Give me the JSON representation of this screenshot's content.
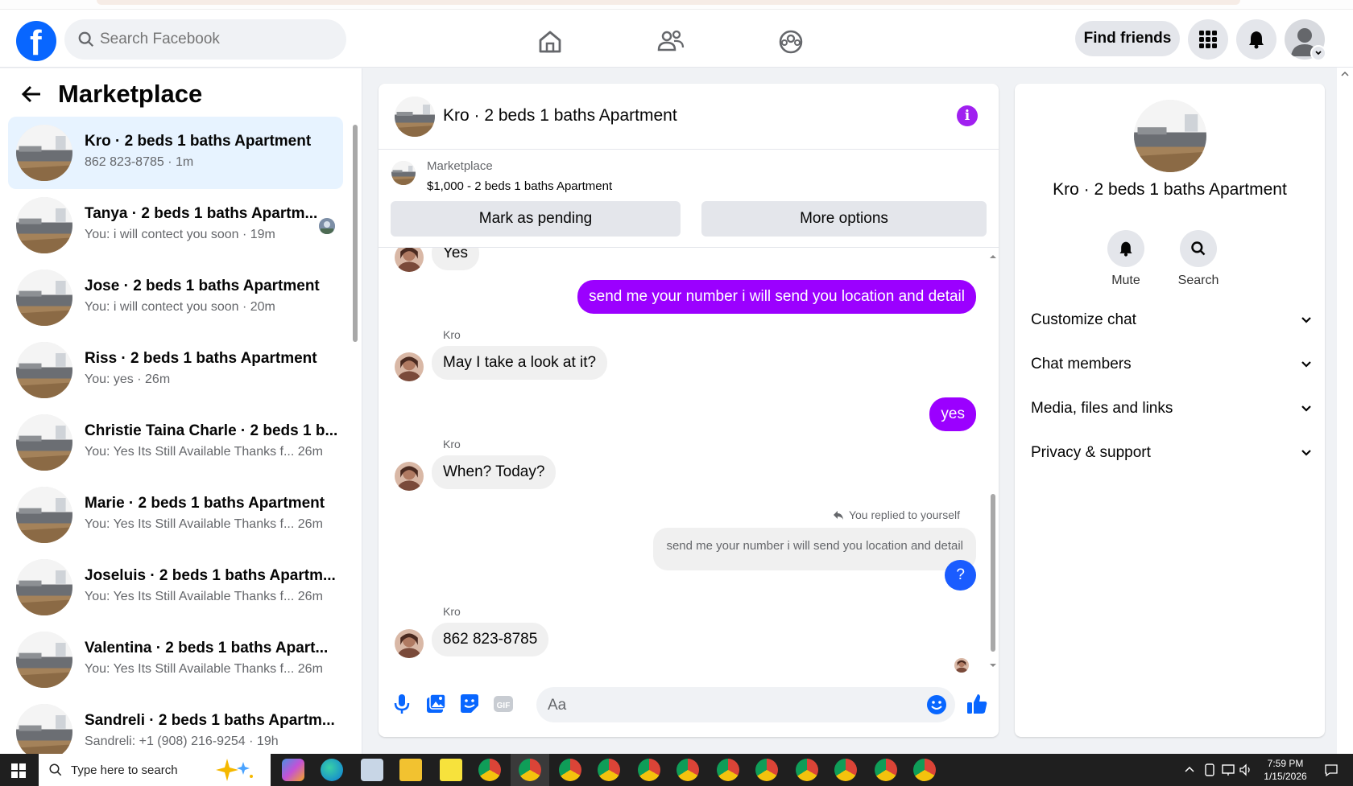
{
  "header": {
    "search_placeholder": "Search Facebook",
    "find_friends": "Find friends"
  },
  "sidebar": {
    "title": "Marketplace",
    "conversations": [
      {
        "name": "Kro · 2 beds 1 baths Apartment",
        "preview": "862 823-8785",
        "time": "1m"
      },
      {
        "name": "Tanya · 2 beds 1 baths Apartm...",
        "preview": "You: i will contect you soon",
        "time": "19m"
      },
      {
        "name": "Jose · 2 beds 1 baths Apartment",
        "preview": "You: i will contect you soon",
        "time": "20m"
      },
      {
        "name": "Riss · 2 beds 1 baths Apartment",
        "preview": "You: yes",
        "time": "26m"
      },
      {
        "name": "Christie Taina Charle · 2 beds 1 b...",
        "preview": "You: Yes Its Still Available Thanks f...",
        "time": "26m"
      },
      {
        "name": "Marie · 2 beds 1 baths Apartment",
        "preview": "You: Yes Its Still Available Thanks f...",
        "time": "26m"
      },
      {
        "name": "Joseluis · 2 beds 1 baths Apartm...",
        "preview": "You: Yes Its Still Available Thanks f...",
        "time": "26m"
      },
      {
        "name": "Valentina · 2 beds 1 baths Apart...",
        "preview": "You: Yes Its Still Available Thanks f...",
        "time": "26m"
      },
      {
        "name": "Sandreli · 2 beds 1 baths Apartm...",
        "preview": "Sandreli: +1 (908) 216-9254",
        "time": "19h"
      }
    ]
  },
  "chat": {
    "title": "Kro · 2 beds 1 baths Apartment",
    "listing_category": "Marketplace",
    "listing_price": "$1,000 - 2 beds 1 baths Apartment",
    "mark_pending": "Mark as pending",
    "more_options": "More options",
    "messages": {
      "m1": "Yes",
      "m2": "send me your number i will send you location and detail",
      "sender": "Kro",
      "m3": "May I take a look at it?",
      "m4": "yes",
      "m5": "When? Today?",
      "replied_label": "You replied to yourself",
      "quoted": "send me your number i will send you location and detail",
      "m6": "?",
      "m7": "862 823-8785"
    },
    "composer_placeholder": "Aa"
  },
  "details": {
    "title": "Kro · 2 beds 1 baths Apartment",
    "mute": "Mute",
    "search": "Search",
    "sections": [
      "Customize chat",
      "Chat members",
      "Media, files and links",
      "Privacy & support"
    ]
  },
  "taskbar": {
    "search_placeholder": "Type here to search",
    "time": "7:59 PM",
    "date": "1/15/2026"
  },
  "colors": {
    "fb_blue": "#0866ff",
    "outgoing_bubble": "#9b00ff",
    "info_icon": "#a020f0",
    "active_row": "#e7f3ff"
  }
}
